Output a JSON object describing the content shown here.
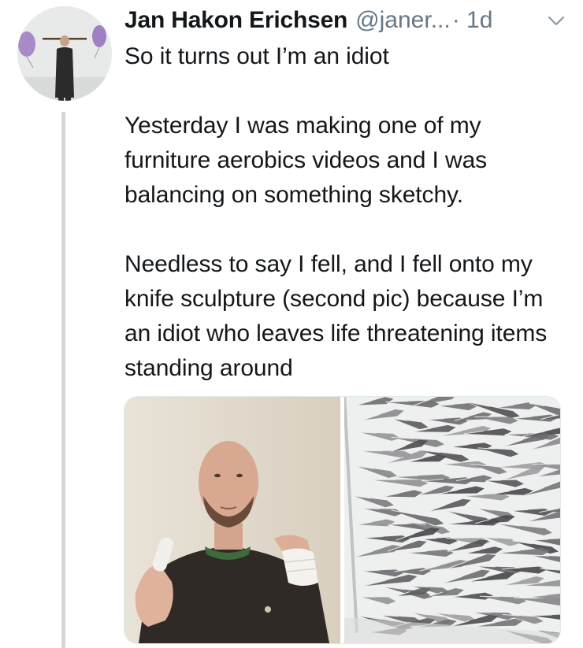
{
  "tweet": {
    "author": {
      "display_name": "Jan Hakon Erichsen",
      "handle": "@janer...",
      "avatar_icon": "avatar-photo"
    },
    "timestamp": "· 1d",
    "menu_icon": "chevron-down-icon",
    "text_paragraphs": [
      "So it turns out I’m an idiot",
      "Yesterday I was making one of my furniture aerobics videos and I was balancing on something sketchy.",
      "Needless to say I fell, and I fell onto my knife sculpture (second pic) because I’m an idiot who leaves life threatening items standing around"
    ],
    "media": [
      {
        "kind": "photo",
        "subject": "man-with-bandaged-fingers"
      },
      {
        "kind": "photo",
        "subject": "knife-sculpture"
      }
    ]
  },
  "colors": {
    "text_primary": "#14171a",
    "text_secondary": "#657786",
    "thread_line": "#cfd7dd",
    "border": "#e1e8ed"
  }
}
